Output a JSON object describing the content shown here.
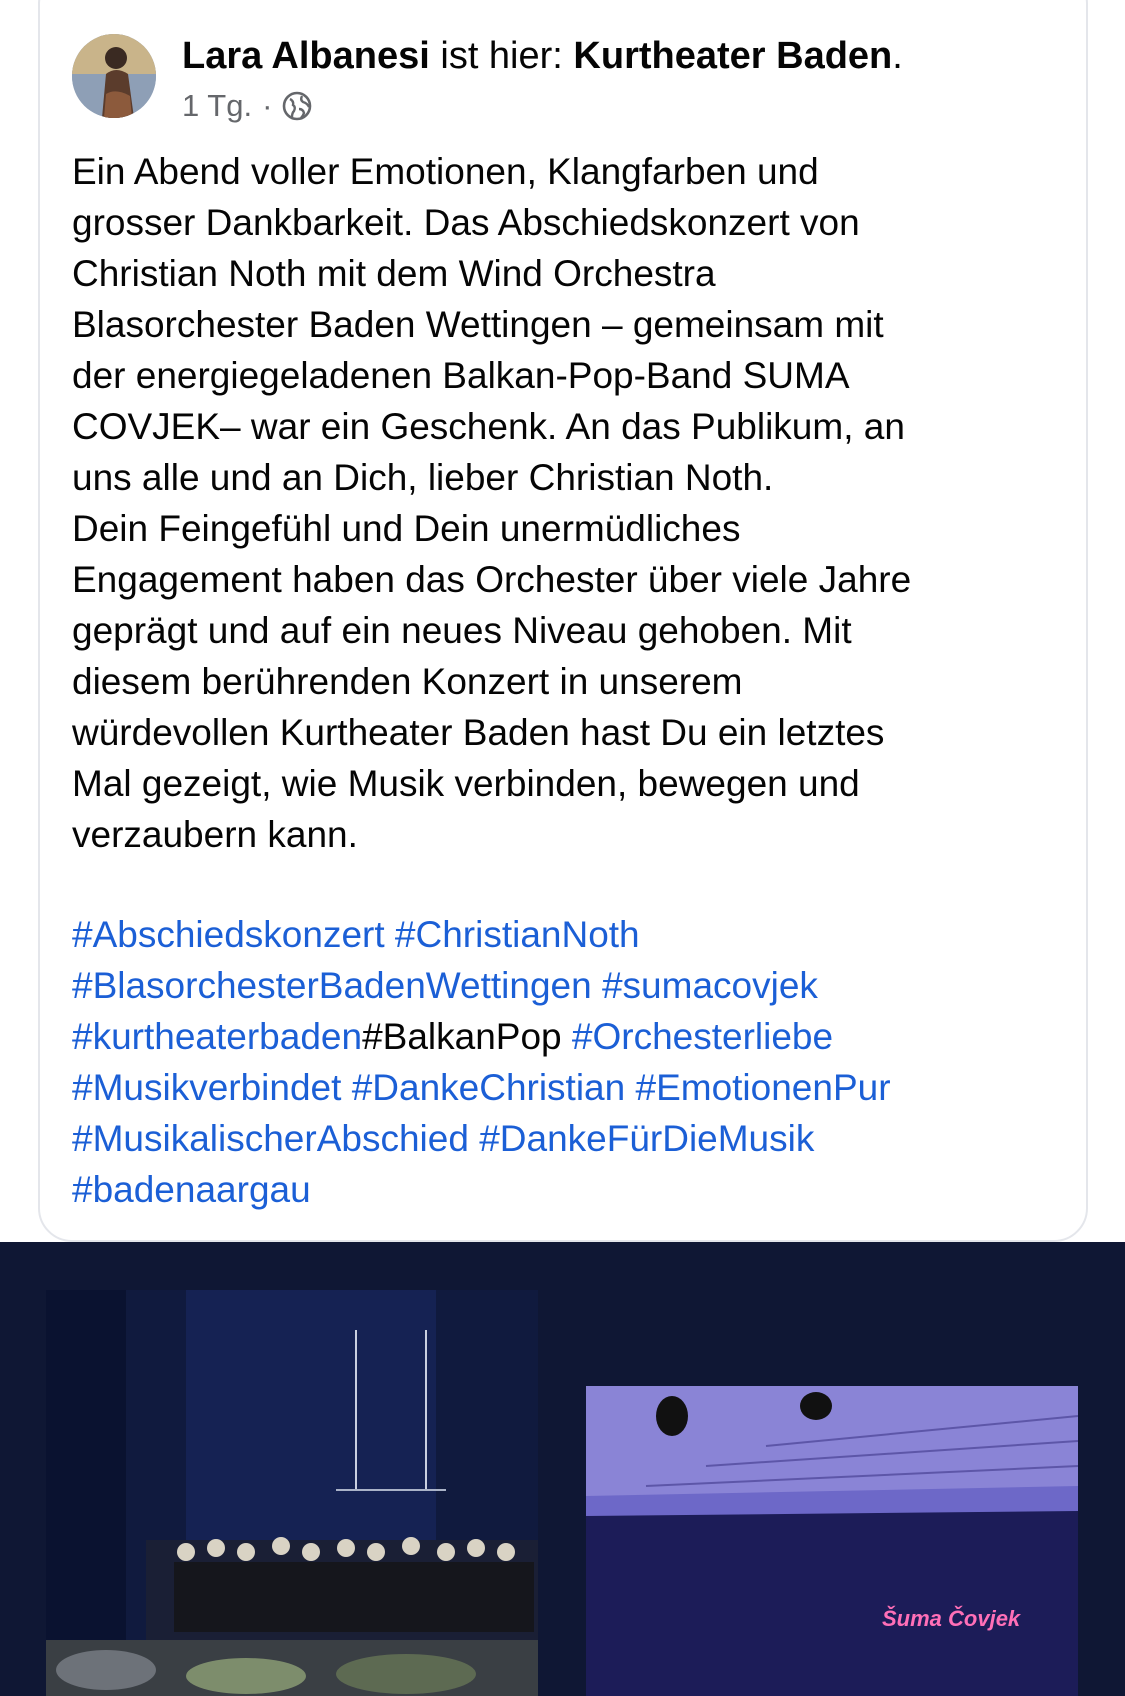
{
  "post": {
    "author": "Lara Albanesi",
    "action": " ist hier: ",
    "place": "Kurtheater Baden",
    "place_suffix": ".",
    "time": "1 Tg.",
    "dot": "·",
    "audience_icon": "globe-icon",
    "body": "Ein Abend voller Emotionen, Klangfarben und\ngrosser Dankbarkeit. Das Abschiedskonzert von\nChristian Noth mit dem Wind Orchestra\nBlasorchester Baden Wettingen – gemeinsam mit\nder energiegeladenen Balkan-Pop-Band SUMA\nCOVJEK– war ein Geschenk. An das Publikum, an\nuns alle und an Dich, lieber Christian Noth.\nDein Feingefühl und Dein unermüdliches\nEngagement haben das Orchester über viele Jahre\ngeprägt und auf ein neues Niveau gehoben. Mit\ndiesem berührenden Konzert in unserem\nwürdevollen Kurtheater Baden hast Du ein letztes\nMal gezeigt, wie Musik verbinden, bewegen und\nverzaubern kann.",
    "hashtags": {
      "h1": "#Abschiedskonzert",
      "h2": "#ChristianNoth",
      "h3": "#BlasorchesterBadenWettingen",
      "h4": "#sumacovjek",
      "h5": "#kurtheaterbaden",
      "h6": "#BalkanPop",
      "h7": "#Orchesterliebe",
      "h8": "#Musikverbindet",
      "h9": "#DankeChristian",
      "h10": "#EmotionenPur",
      "h11": "#MusikalischerAbschied",
      "h12": "#DankeFürDieMusik",
      "h13": "#badenaargau"
    }
  },
  "photos": {
    "photo2_caption": "Šuma Čovjek"
  },
  "colors": {
    "link": "#1b5fd6",
    "gallery_bg": "#0f1734",
    "secondary_text": "#65676b"
  }
}
